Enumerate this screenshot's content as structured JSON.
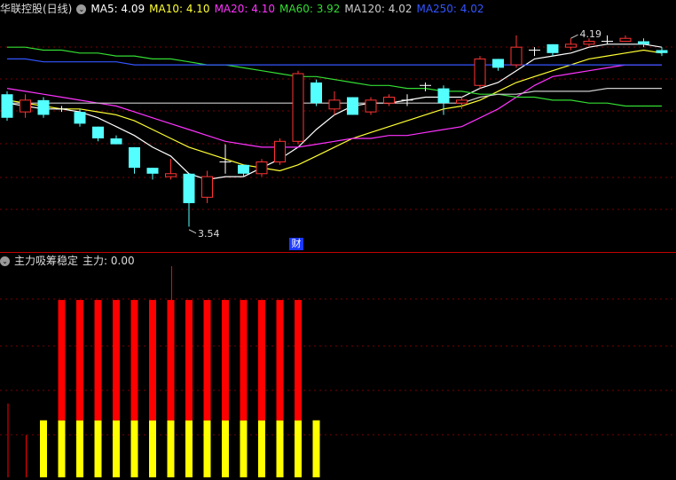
{
  "main_header": {
    "title": "华联控股(日线)",
    "ma": [
      {
        "label": "MA5: 4.09",
        "color": "#ffffff"
      },
      {
        "label": "MA10: 4.10",
        "color": "#ffff33"
      },
      {
        "label": "MA20: 4.10",
        "color": "#ff33ff"
      },
      {
        "label": "MA60: 3.92",
        "color": "#33dd33"
      },
      {
        "label": "MA120: 4.02",
        "color": "#cccccc"
      },
      {
        "label": "MA250: 4.02",
        "color": "#3355ff"
      }
    ]
  },
  "sub_header": {
    "title": "主力吸筹稳定",
    "value": "主力: 0.00"
  },
  "badge": {
    "text": "财"
  },
  "colors": {
    "bg": "#000000",
    "up": "#ff3333",
    "down": "#54ffff",
    "grid": "#7a0000",
    "divider": "#c00000",
    "bar_red": "#ff0000",
    "bar_yellow": "#ffff00"
  },
  "chart_data": [
    {
      "type": "candlestick",
      "title": "华联控股(日线)",
      "ylim": [
        3.47,
        4.26
      ],
      "candles": [
        {
          "o": 4.0,
          "c": 3.92,
          "h": 4.01,
          "l": 3.91
        },
        {
          "o": 3.94,
          "c": 3.98,
          "h": 4.0,
          "l": 3.92
        },
        {
          "o": 3.98,
          "c": 3.93,
          "h": 3.99,
          "l": 3.92
        },
        {
          "o": 3.95,
          "c": 3.95,
          "h": 3.96,
          "l": 3.94
        },
        {
          "o": 3.94,
          "c": 3.9,
          "h": 3.95,
          "l": 3.89
        },
        {
          "o": 3.89,
          "c": 3.85,
          "h": 3.89,
          "l": 3.84
        },
        {
          "o": 3.85,
          "c": 3.83,
          "h": 3.86,
          "l": 3.83
        },
        {
          "o": 3.82,
          "c": 3.75,
          "h": 3.82,
          "l": 3.73
        },
        {
          "o": 3.75,
          "c": 3.73,
          "h": 3.75,
          "l": 3.71
        },
        {
          "o": 3.72,
          "c": 3.73,
          "h": 3.78,
          "l": 3.71
        },
        {
          "o": 3.73,
          "c": 3.63,
          "h": 3.73,
          "l": 3.55
        },
        {
          "o": 3.65,
          "c": 3.72,
          "h": 3.74,
          "l": 3.63
        },
        {
          "o": 3.77,
          "c": 3.77,
          "h": 3.83,
          "l": 3.73
        },
        {
          "o": 3.76,
          "c": 3.73,
          "h": 3.76,
          "l": 3.72
        },
        {
          "o": 3.73,
          "c": 3.77,
          "h": 3.78,
          "l": 3.72
        },
        {
          "o": 3.77,
          "c": 3.84,
          "h": 3.85,
          "l": 3.76
        },
        {
          "o": 3.84,
          "c": 4.07,
          "h": 4.08,
          "l": 3.83
        },
        {
          "o": 4.04,
          "c": 3.97,
          "h": 4.05,
          "l": 3.96
        },
        {
          "o": 3.95,
          "c": 3.98,
          "h": 4.01,
          "l": 3.93
        },
        {
          "o": 3.99,
          "c": 3.93,
          "h": 3.99,
          "l": 3.93
        },
        {
          "o": 3.94,
          "c": 3.98,
          "h": 3.99,
          "l": 3.93
        },
        {
          "o": 3.97,
          "c": 3.99,
          "h": 4.0,
          "l": 3.96
        },
        {
          "o": 3.98,
          "c": 3.98,
          "h": 4.0,
          "l": 3.96
        },
        {
          "o": 4.03,
          "c": 4.03,
          "h": 4.04,
          "l": 4.01
        },
        {
          "o": 4.02,
          "c": 3.97,
          "h": 4.03,
          "l": 3.93
        },
        {
          "o": 3.97,
          "c": 3.98,
          "h": 3.99,
          "l": 3.95
        },
        {
          "o": 4.03,
          "c": 4.12,
          "h": 4.13,
          "l": 4.02
        },
        {
          "o": 4.12,
          "c": 4.09,
          "h": 4.12,
          "l": 4.08
        },
        {
          "o": 4.1,
          "c": 4.16,
          "h": 4.2,
          "l": 4.09
        },
        {
          "o": 4.15,
          "c": 4.15,
          "h": 4.16,
          "l": 4.13
        },
        {
          "o": 4.17,
          "c": 4.14,
          "h": 4.17,
          "l": 4.13
        },
        {
          "o": 4.16,
          "c": 4.17,
          "h": 4.19,
          "l": 4.15
        },
        {
          "o": 4.17,
          "c": 4.18,
          "h": 4.19,
          "l": 4.16
        },
        {
          "o": 4.18,
          "c": 4.18,
          "h": 4.2,
          "l": 4.17
        },
        {
          "o": 4.18,
          "c": 4.19,
          "h": 4.2,
          "l": 4.18
        },
        {
          "o": 4.18,
          "c": 4.17,
          "h": 4.19,
          "l": 4.16
        },
        {
          "o": 4.15,
          "c": 4.14,
          "h": 4.16,
          "l": 4.13
        }
      ],
      "series": [
        {
          "name": "MA5",
          "color": "#ffffff",
          "values": [
            3.97,
            3.96,
            3.95,
            3.95,
            3.94,
            3.92,
            3.89,
            3.86,
            3.82,
            3.79,
            3.73,
            3.71,
            3.72,
            3.72,
            3.75,
            3.78,
            3.82,
            3.88,
            3.93,
            3.96,
            3.97,
            3.97,
            3.98,
            3.99,
            3.99,
            3.99,
            4.02,
            4.04,
            4.08,
            4.12,
            4.13,
            4.14,
            4.16,
            4.17,
            4.17,
            4.17,
            4.16
          ]
        },
        {
          "name": "MA10",
          "color": "#ffff33",
          "values": [
            3.98,
            3.97,
            3.96,
            3.95,
            3.95,
            3.94,
            3.93,
            3.91,
            3.88,
            3.85,
            3.82,
            3.8,
            3.78,
            3.76,
            3.75,
            3.74,
            3.76,
            3.79,
            3.82,
            3.85,
            3.87,
            3.89,
            3.91,
            3.93,
            3.95,
            3.96,
            3.98,
            4.01,
            4.04,
            4.06,
            4.08,
            4.1,
            4.12,
            4.13,
            4.14,
            4.15,
            4.14
          ]
        },
        {
          "name": "MA20",
          "color": "#ff33ff",
          "values": [
            4.02,
            4.01,
            4.0,
            3.99,
            3.98,
            3.97,
            3.96,
            3.94,
            3.92,
            3.9,
            3.88,
            3.86,
            3.84,
            3.83,
            3.82,
            3.82,
            3.82,
            3.83,
            3.84,
            3.85,
            3.85,
            3.86,
            3.86,
            3.87,
            3.88,
            3.89,
            3.92,
            3.95,
            3.99,
            4.03,
            4.06,
            4.07,
            4.08,
            4.09,
            4.1,
            4.1,
            4.1
          ]
        },
        {
          "name": "MA60",
          "color": "#33dd33",
          "values": [
            4.16,
            4.16,
            4.15,
            4.15,
            4.14,
            4.14,
            4.13,
            4.13,
            4.12,
            4.12,
            4.11,
            4.1,
            4.1,
            4.09,
            4.08,
            4.07,
            4.06,
            4.06,
            4.05,
            4.04,
            4.03,
            4.03,
            4.02,
            4.02,
            4.01,
            4.01,
            4.0,
            4.0,
            3.99,
            3.99,
            3.98,
            3.98,
            3.97,
            3.97,
            3.96,
            3.96,
            3.96
          ]
        },
        {
          "name": "MA120",
          "color": "#cccccc",
          "values": [
            3.97,
            3.97,
            3.97,
            3.97,
            3.97,
            3.97,
            3.97,
            3.97,
            3.97,
            3.97,
            3.97,
            3.97,
            3.97,
            3.97,
            3.97,
            3.97,
            3.97,
            3.97,
            3.97,
            3.97,
            3.97,
            3.97,
            3.97,
            3.97,
            3.97,
            3.97,
            3.99,
            4.0,
            4.0,
            4.01,
            4.01,
            4.01,
            4.01,
            4.02,
            4.02,
            4.02,
            4.02
          ]
        },
        {
          "name": "MA250",
          "color": "#3355ff",
          "values": [
            4.12,
            4.12,
            4.11,
            4.11,
            4.11,
            4.11,
            4.11,
            4.1,
            4.1,
            4.1,
            4.1,
            4.1,
            4.1,
            4.1,
            4.1,
            4.1,
            4.1,
            4.1,
            4.1,
            4.1,
            4.1,
            4.1,
            4.1,
            4.1,
            4.1,
            4.1,
            4.1,
            4.1,
            4.1,
            4.1,
            4.1,
            4.1,
            4.1,
            4.1,
            4.1,
            4.1,
            4.1
          ]
        }
      ],
      "annotations": [
        {
          "index": 10,
          "value": 3.54,
          "text": "3.54"
        },
        {
          "index": 31,
          "value": 4.19,
          "text": "4.19"
        }
      ]
    },
    {
      "type": "bar",
      "title": "主力吸筹稳定",
      "ylim": [
        0,
        100
      ],
      "values": [
        {
          "red": 0,
          "yellow": 0,
          "thin": 35
        },
        {
          "red": 0,
          "yellow": 0,
          "thin": 20
        },
        {
          "red": 0,
          "yellow": 27,
          "thin": 0
        },
        {
          "red": 57,
          "yellow": 27,
          "thin": 0
        },
        {
          "red": 57,
          "yellow": 27,
          "thin": 0
        },
        {
          "red": 57,
          "yellow": 27,
          "thin": 0
        },
        {
          "red": 57,
          "yellow": 27,
          "thin": 0
        },
        {
          "red": 57,
          "yellow": 27,
          "thin": 0
        },
        {
          "red": 57,
          "yellow": 27,
          "thin": 0
        },
        {
          "red": 57,
          "yellow": 27,
          "thin": 100
        },
        {
          "red": 57,
          "yellow": 27,
          "thin": 0
        },
        {
          "red": 57,
          "yellow": 27,
          "thin": 0
        },
        {
          "red": 57,
          "yellow": 27,
          "thin": 0
        },
        {
          "red": 57,
          "yellow": 27,
          "thin": 0
        },
        {
          "red": 57,
          "yellow": 27,
          "thin": 0
        },
        {
          "red": 57,
          "yellow": 27,
          "thin": 0
        },
        {
          "red": 57,
          "yellow": 27,
          "thin": 0
        },
        {
          "red": 0,
          "yellow": 27,
          "thin": 0
        }
      ]
    }
  ]
}
